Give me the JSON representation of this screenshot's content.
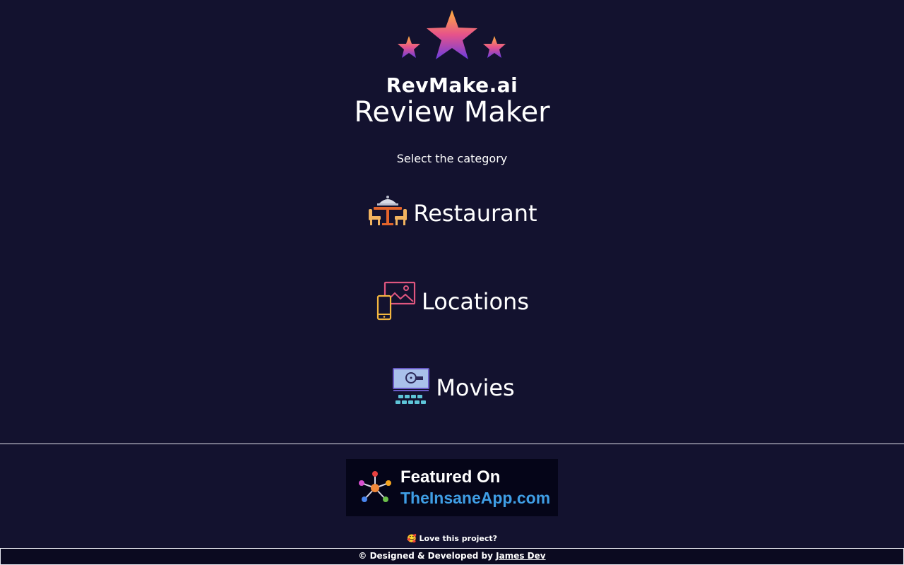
{
  "logo": {
    "icon": "three-stars-icon",
    "text": "RevMake.ai"
  },
  "title": "Review Maker",
  "subtitle": "Select the category",
  "categories": [
    {
      "label": "Restaurant",
      "icon": "restaurant-table-icon"
    },
    {
      "label": "Locations",
      "icon": "location-photo-icon"
    },
    {
      "label": "Movies",
      "icon": "cinema-screen-icon"
    }
  ],
  "badge": {
    "line1": "Featured On",
    "line2": "TheInsaneApp.com",
    "icon": "network-nodes-icon"
  },
  "footer": {
    "love_emoji": "🥰",
    "love_text": "Love this project?",
    "credit_prefix": "© Designed & Developed by",
    "credit_name": "James Dev"
  },
  "colors": {
    "background": "#13122f",
    "badge_background": "#050518",
    "badge_link": "#3f9ee5"
  }
}
